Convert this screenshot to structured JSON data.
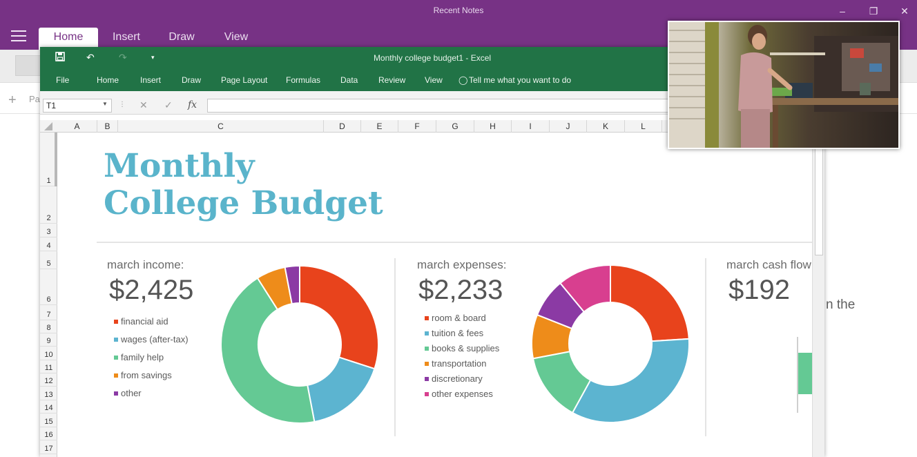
{
  "onenote": {
    "title": "Recent Notes",
    "tabs": [
      "Home",
      "Insert",
      "Draw",
      "View"
    ],
    "add_page_text": "Pa",
    "snippet_text": "n the"
  },
  "excel": {
    "title": "Monthly college budget1  -  Excel",
    "menu": [
      "File",
      "Home",
      "Insert",
      "Draw",
      "Page Layout",
      "Formulas",
      "Data",
      "Review",
      "View"
    ],
    "tell_me": "Tell me what you want to do",
    "name_box": "T1",
    "columns": [
      "A",
      "B",
      "C",
      "D",
      "E",
      "F",
      "G",
      "H",
      "I",
      "J",
      "K",
      "L"
    ],
    "rows": [
      "1",
      "2",
      "3",
      "4",
      "5",
      "6",
      "7",
      "8",
      "9",
      "10",
      "11",
      "12",
      "13",
      "14",
      "15",
      "16",
      "17"
    ]
  },
  "sheet": {
    "title_line1": "Monthly",
    "title_line2": "College Budget",
    "income": {
      "label": "march income:",
      "value": "$2,425",
      "legend": [
        "financial aid",
        "wages (after-tax)",
        "family help",
        "from savings",
        "other"
      ]
    },
    "expenses": {
      "label": "march expenses:",
      "value": "$2,233",
      "legend": [
        "room & board",
        "tuition & fees",
        "books & supplies",
        "transportation",
        "discretionary",
        "other expenses"
      ]
    },
    "cashflow": {
      "label": "march cash flow",
      "value": "$192"
    }
  },
  "colors": {
    "onenote_purple": "#773285",
    "excel_green": "#217346",
    "title_blue": "#5ab4cb",
    "red": "#e8431c",
    "blue": "#5cb4d0",
    "green": "#64c994",
    "orange": "#ee8c1a",
    "purple": "#8b3aa4",
    "pink": "#d83f8f"
  },
  "chart_data": [
    {
      "type": "pie",
      "donut": true,
      "categories": [
        "financial aid",
        "wages (after-tax)",
        "family help",
        "from savings",
        "other"
      ],
      "values": [
        30,
        17,
        44,
        6,
        3
      ],
      "colors": [
        "#e8431c",
        "#5cb4d0",
        "#64c994",
        "#ee8c1a",
        "#8b3aa4"
      ]
    },
    {
      "type": "pie",
      "donut": true,
      "categories": [
        "room & board",
        "tuition & fees",
        "books & supplies",
        "transportation",
        "discretionary",
        "other expenses"
      ],
      "values": [
        24,
        34,
        14,
        9,
        8,
        11
      ],
      "colors": [
        "#e8431c",
        "#5cb4d0",
        "#64c994",
        "#ee8c1a",
        "#8b3aa4",
        "#d83f8f"
      ]
    }
  ]
}
